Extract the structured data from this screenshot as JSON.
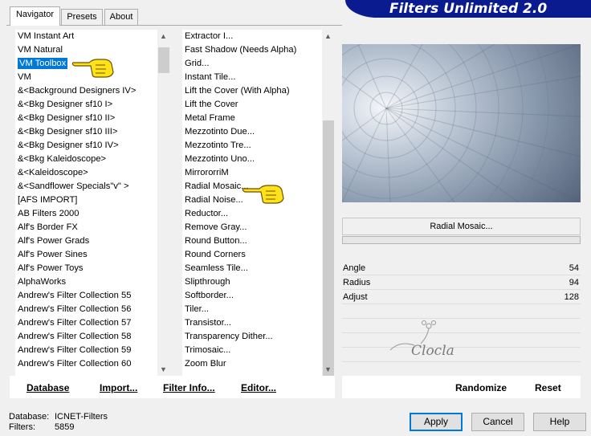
{
  "banner": {
    "title": "Filters Unlimited 2.0"
  },
  "tabs": [
    {
      "label": "Navigator"
    },
    {
      "label": "Presets"
    },
    {
      "label": "About"
    }
  ],
  "categories": [
    {
      "label": "VM Instant Art"
    },
    {
      "label": "VM Natural"
    },
    {
      "label": "VM Toolbox",
      "selected": true
    },
    {
      "label": "VM"
    },
    {
      "label": "&<Background Designers IV>"
    },
    {
      "label": "&<Bkg Designer sf10 I>"
    },
    {
      "label": "&<Bkg Designer sf10 II>"
    },
    {
      "label": "&<Bkg Designer sf10 III>"
    },
    {
      "label": "&<Bkg Designer sf10 IV>"
    },
    {
      "label": "&<Bkg Kaleidoscope>"
    },
    {
      "label": "&<Kaleidoscope>"
    },
    {
      "label": "&<Sandflower Specials\"v\" >"
    },
    {
      "label": "[AFS IMPORT]"
    },
    {
      "label": "AB Filters 2000"
    },
    {
      "label": "Alf's Border FX"
    },
    {
      "label": "Alf's Power Grads"
    },
    {
      "label": "Alf's Power Sines"
    },
    {
      "label": "Alf's Power Toys"
    },
    {
      "label": "AlphaWorks"
    },
    {
      "label": "Andrew's Filter Collection 55"
    },
    {
      "label": "Andrew's Filter Collection 56"
    },
    {
      "label": "Andrew's Filter Collection 57"
    },
    {
      "label": "Andrew's Filter Collection 58"
    },
    {
      "label": "Andrew's Filter Collection 59"
    },
    {
      "label": "Andrew's Filter Collection 60"
    }
  ],
  "filters": [
    {
      "label": "Extractor I..."
    },
    {
      "label": "Fast Shadow (Needs Alpha)"
    },
    {
      "label": "Grid..."
    },
    {
      "label": "Instant Tile..."
    },
    {
      "label": "Lift the Cover (With Alpha)"
    },
    {
      "label": "Lift the Cover"
    },
    {
      "label": "Metal Frame"
    },
    {
      "label": "Mezzotinto Due..."
    },
    {
      "label": "Mezzotinto Tre..."
    },
    {
      "label": "Mezzotinto Uno..."
    },
    {
      "label": "MirrororriM"
    },
    {
      "label": "Radial Mosaic..."
    },
    {
      "label": "Radial Noise..."
    },
    {
      "label": "Reductor..."
    },
    {
      "label": "Remove Gray..."
    },
    {
      "label": "Round Button..."
    },
    {
      "label": "Round Corners"
    },
    {
      "label": "Seamless Tile..."
    },
    {
      "label": "Slipthrough"
    },
    {
      "label": "Softborder..."
    },
    {
      "label": "Tiler..."
    },
    {
      "label": "Transistor..."
    },
    {
      "label": "Transparency Dither..."
    },
    {
      "label": "Trimosaic..."
    },
    {
      "label": "Zoom Blur"
    }
  ],
  "preview": {
    "filter_name": "Radial Mosaic..."
  },
  "params": [
    {
      "label": "Angle",
      "value": "54"
    },
    {
      "label": "Radius",
      "value": "94"
    },
    {
      "label": "Adjust",
      "value": "128"
    }
  ],
  "watermark": {
    "text": "Clocla"
  },
  "toolbar": {
    "database": "Database",
    "import": "Import...",
    "filter_info": "Filter Info...",
    "editor": "Editor...",
    "randomize": "Randomize",
    "reset": "Reset"
  },
  "dialog": {
    "apply": "Apply",
    "cancel": "Cancel",
    "help": "Help"
  },
  "status": {
    "database_label": "Database:",
    "database_value": "ICNET-Filters",
    "filters_label": "Filters:",
    "filters_value": "5859"
  },
  "colors": {
    "selection": "#0078d7",
    "banner": "#0a1a8f"
  }
}
